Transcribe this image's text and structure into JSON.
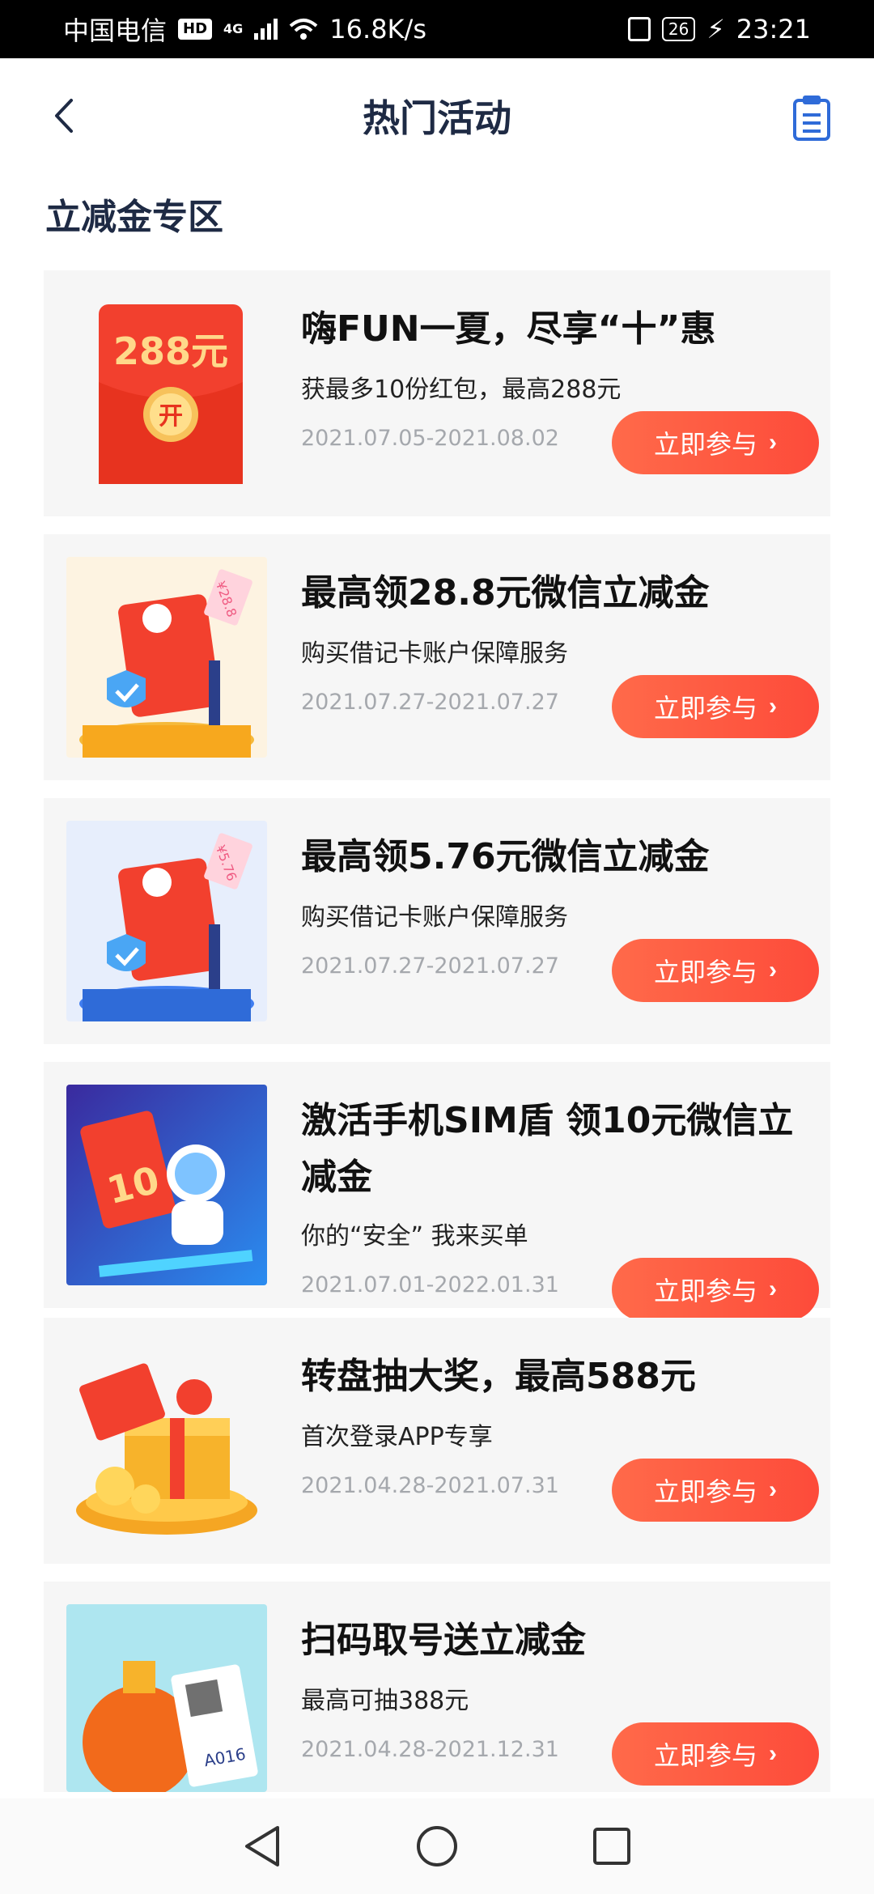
{
  "status_bar": {
    "carrier": "中国电信",
    "hd_label": "HD",
    "network": "4G",
    "speed": "16.8K/s",
    "battery": "26",
    "time": "23:21"
  },
  "header": {
    "title": "热门活动",
    "back_icon": "chevron-left-icon",
    "right_icon": "clipboard-icon"
  },
  "section": {
    "title": "立减金专区"
  },
  "cards": [
    {
      "title": "嗨FUN一夏，尽享“十”惠",
      "desc": "获最多10份红包，最高288元",
      "date": "2021.07.05-2021.08.02",
      "button": "立即参与",
      "thumb_text": "288元",
      "thumb_sub": "开"
    },
    {
      "title": "最高领28.8元微信立减金",
      "desc": "购买借记卡账户保障服务",
      "date": "2021.07.27-2021.07.27",
      "button": "立即参与",
      "thumb_text": "¥28.8"
    },
    {
      "title": "最高领5.76元微信立减金",
      "desc": "购买借记卡账户保障服务",
      "date": "2021.07.27-2021.07.27",
      "button": "立即参与",
      "thumb_text": "¥5.76"
    },
    {
      "title": "激活手机SIM盾 领10元微信立减金",
      "desc": "你的“安全” 我来买单",
      "date": "2021.07.01-2022.01.31",
      "button": "立即参与",
      "thumb_text": "10"
    },
    {
      "title": "转盘抽大奖，最高588元",
      "desc": "首次登录APP专享",
      "date": "2021.04.28-2021.07.31",
      "button": "立即参与"
    },
    {
      "title": "扫码取号送立减金",
      "desc": "最高可抽388元",
      "date": "2021.04.28-2021.12.31",
      "button": "立即参与",
      "thumb_text": "A016"
    }
  ],
  "colors": {
    "accent": "#fd4b3a",
    "title": "#1e2a44",
    "date": "#a5a8ad"
  }
}
